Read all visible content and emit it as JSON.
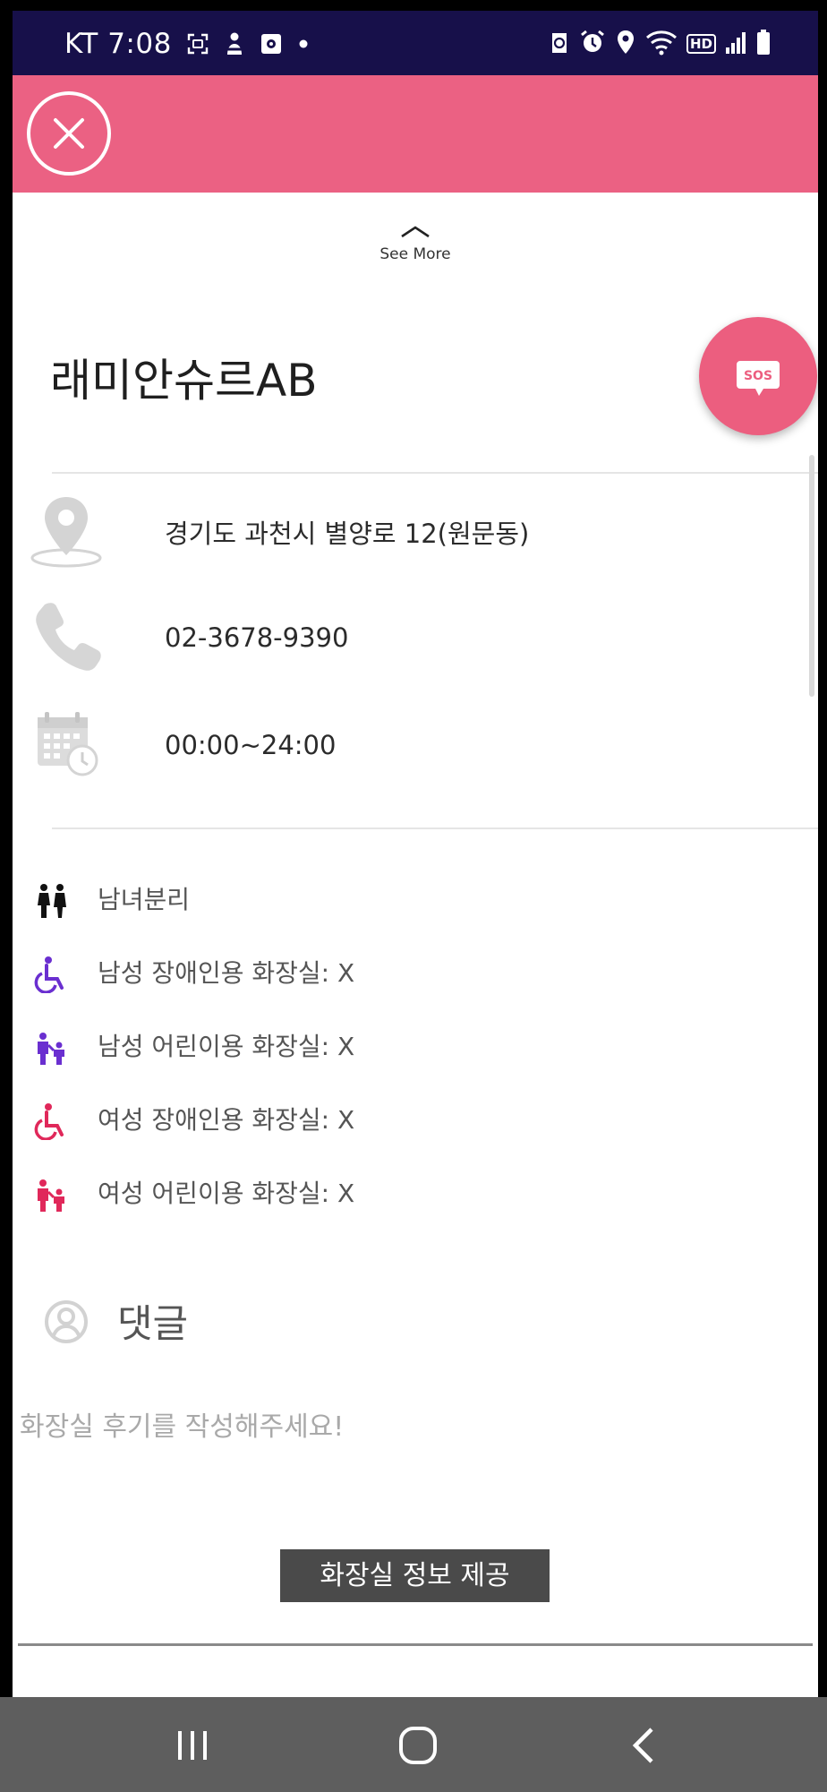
{
  "status_bar": {
    "time": "KT 7:08",
    "icons_left": [
      "screen-capture-icon",
      "person-icon",
      "media-icon",
      "dot-icon"
    ],
    "icons_right": [
      "app-notification-icon",
      "alarm-icon",
      "location-icon",
      "wifi-icon",
      "hd-icon",
      "signal-icon",
      "battery-icon"
    ],
    "hd_label": "HD"
  },
  "header": {
    "background_color": "#eb6183",
    "close_icon": "close-icon"
  },
  "see_more": {
    "label": "See More",
    "icon": "chevron-up-icon"
  },
  "place": {
    "name": "래미안슈르AB"
  },
  "sos": {
    "label": "SOS",
    "color": "#ec5e7f"
  },
  "info": {
    "address": "경기도 과천시 별양로 12(원문동)",
    "phone": "02-3678-9390",
    "hours": "00:00~24:00"
  },
  "features": [
    {
      "icon": "gender-separated-icon",
      "label": "남녀분리",
      "color": "#111111"
    },
    {
      "icon": "wheelchair-icon",
      "label": "남성 장애인용 화장실: X",
      "color": "#6a2fd0"
    },
    {
      "icon": "child-toilet-icon",
      "label": "남성 어린이용 화장실: X",
      "color": "#6a2fd0"
    },
    {
      "icon": "wheelchair-icon",
      "label": "여성 장애인용 화장실: X",
      "color": "#e0285a"
    },
    {
      "icon": "child-toilet-icon",
      "label": "여성 어린이용 화장실: X",
      "color": "#e0285a"
    }
  ],
  "comments": {
    "title": "댓글",
    "icon": "user-icon",
    "placeholder": "화장실 후기를 작성해주세요!"
  },
  "caption": "화장실 정보 제공",
  "nav_bar": {
    "buttons": [
      "recent-apps-icon",
      "home-icon",
      "back-icon"
    ]
  }
}
